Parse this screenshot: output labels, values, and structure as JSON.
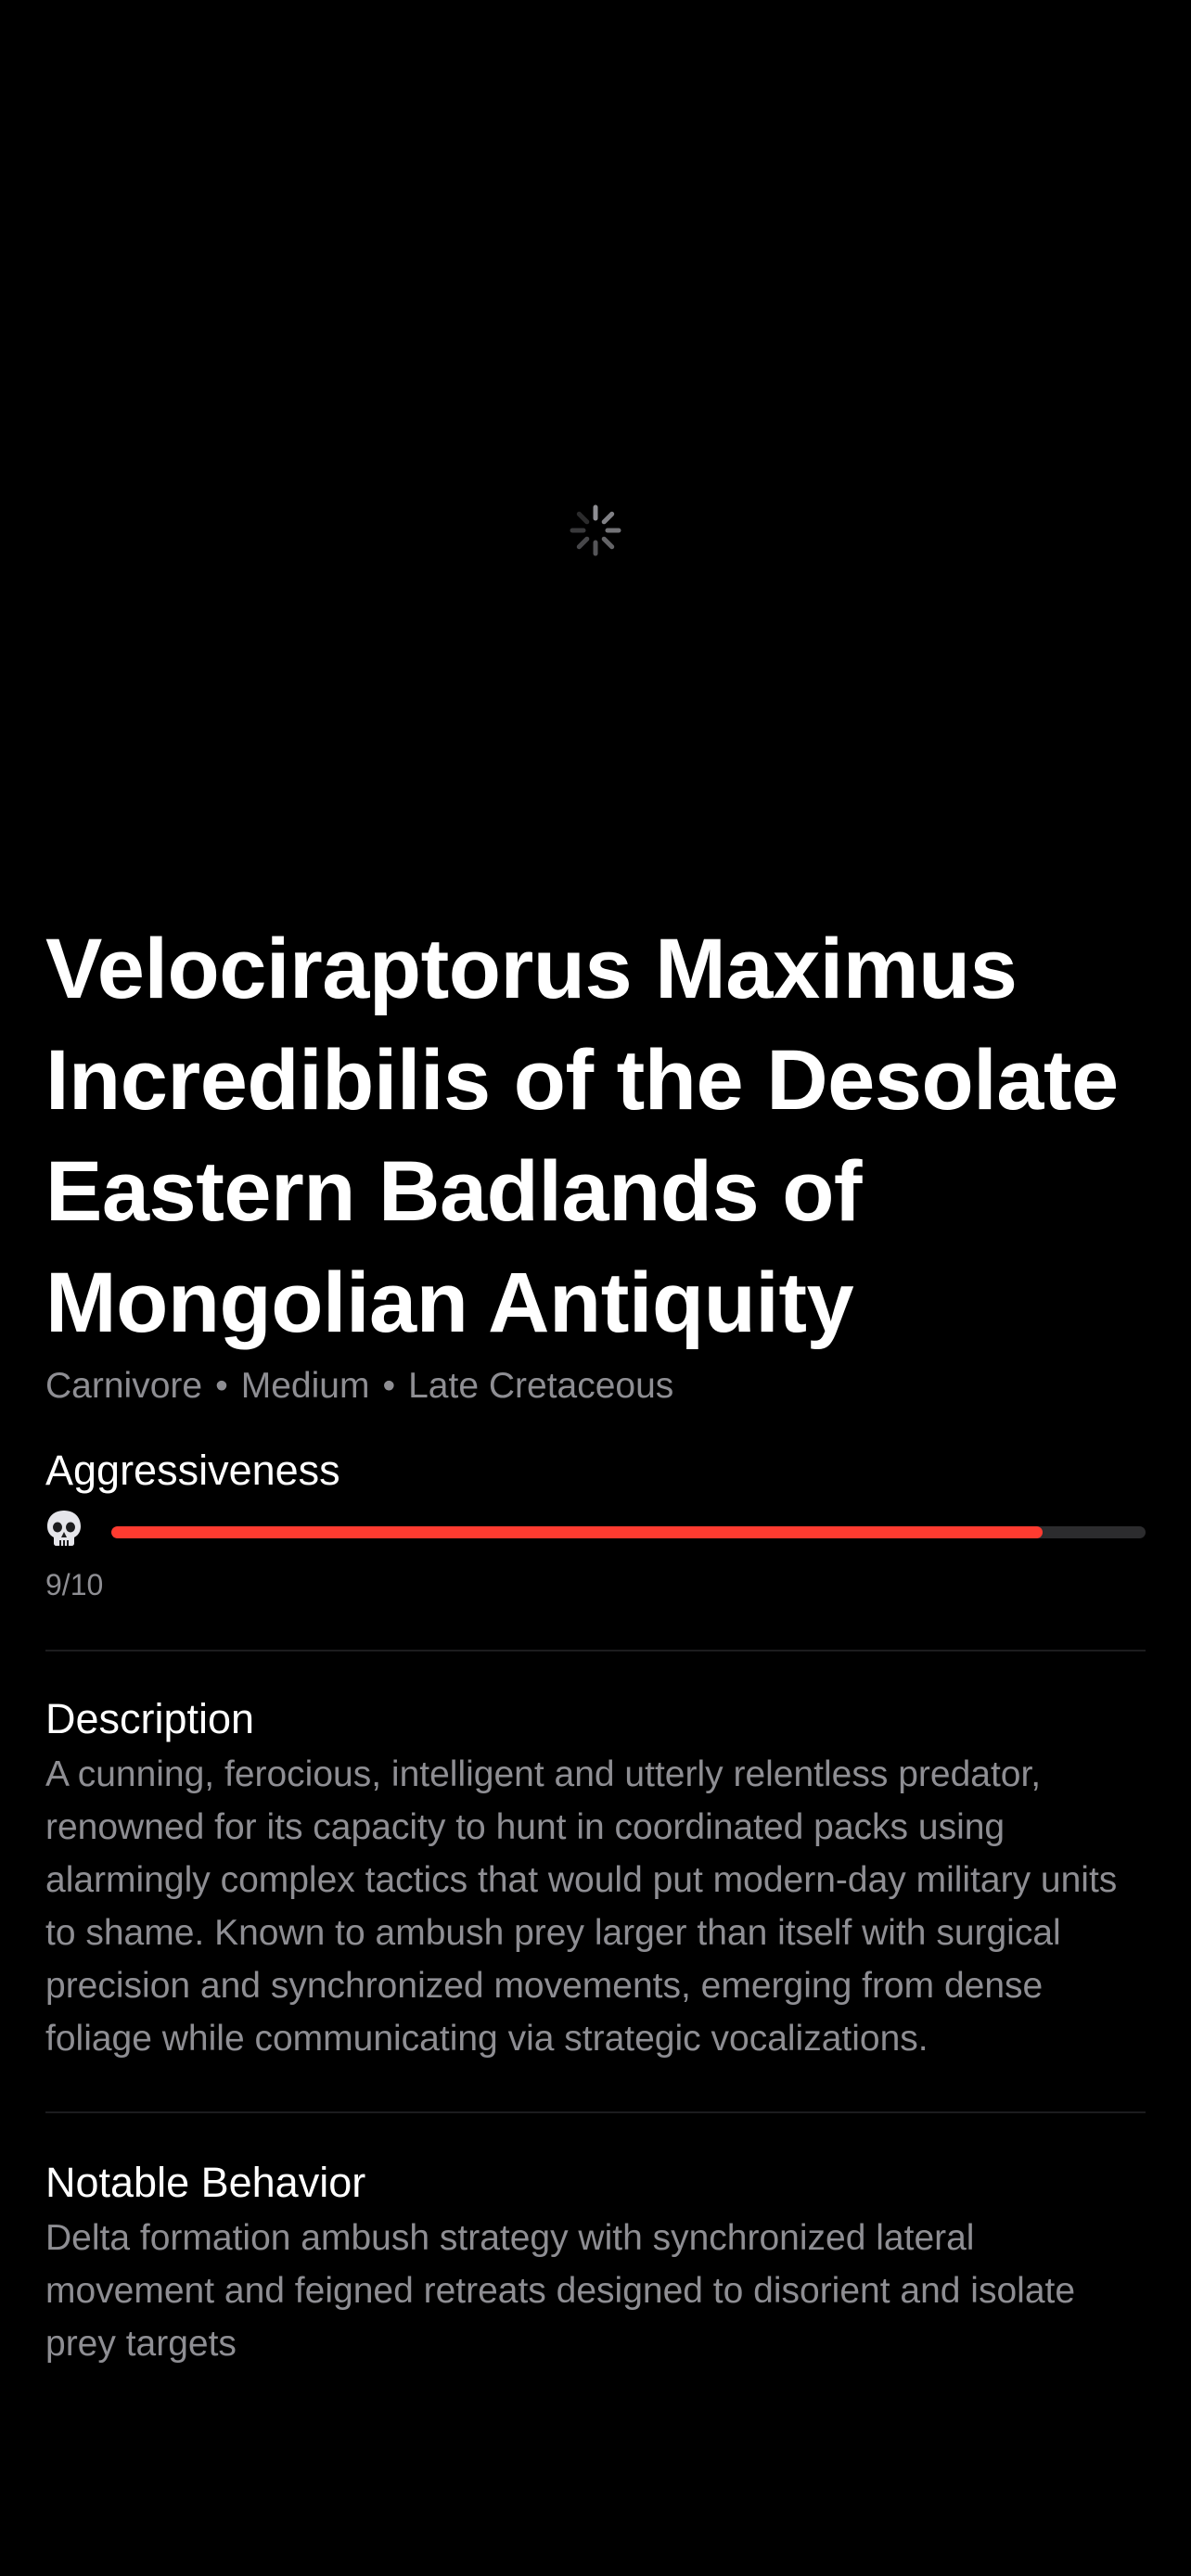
{
  "hero": {
    "loading_icon": "activity-spinner-icon"
  },
  "dino": {
    "title": "Velociraptorus Maximus Incredibilis of the Desolate Eastern Badlands of Mongolian Antiquity",
    "diet": "Carnivore",
    "size": "Medium",
    "period": "Late Cretaceous",
    "separator": "•"
  },
  "aggressiveness": {
    "label": "Aggressiveness",
    "icon": "skull-icon",
    "value": 9,
    "max": 10,
    "score_text": "9/10",
    "bar_color": "#ff3b30",
    "track_color": "#2c2c2e"
  },
  "description": {
    "label": "Description",
    "text": "A cunning, ferocious, intelligent and utterly relentless predator, renowned for its capacity to hunt in coordinated packs using alarmingly complex tactics that would put modern-day military units to shame. Known to ambush prey larger than itself with surgical precision and synchronized movements, emerging from dense foliage while communicating via strategic vocalizations."
  },
  "notable_behavior": {
    "label": "Notable Behavior",
    "text": "Delta formation ambush strategy with synchronized lateral movement and feigned retreats designed to disorient and isolate prey targets"
  }
}
